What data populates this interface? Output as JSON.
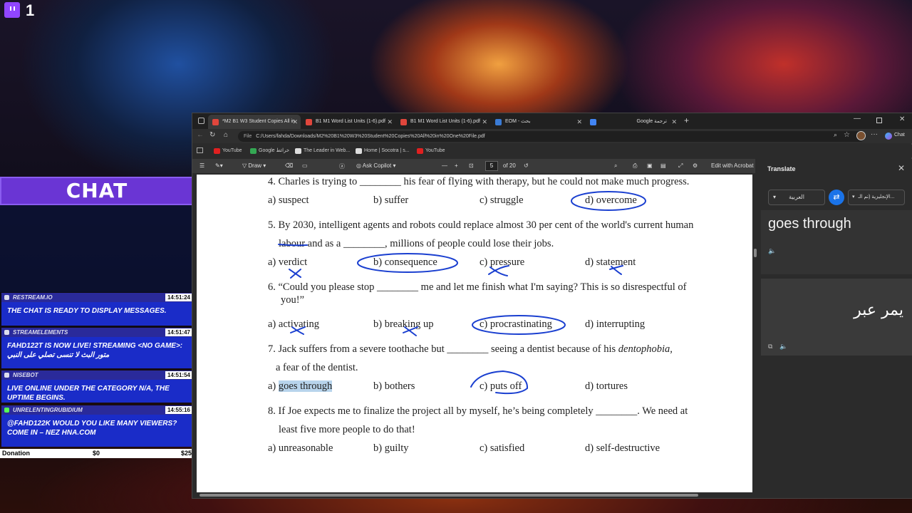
{
  "twitch": {
    "viewer_count": "1"
  },
  "chat": {
    "header": "CHAT",
    "messages": [
      {
        "user": "RESTREAM.IO",
        "time": "14:51:24",
        "text": "THE CHAT IS READY TO DISPLAY MESSAGES."
      },
      {
        "user": "STREAMELEMENTS",
        "time": "14:51:47",
        "text": "FAHD122T IS NOW LIVE! STREAMING <NO GAME>: متور البث لا تنسى تصلي على النبي"
      },
      {
        "user": "NISEBOT",
        "time": "14:51:54",
        "text": "LIVE ONLINE UNDER THE CATEGORY N/A, THE UPTIME BEGINS."
      },
      {
        "user": "UNRELENTINGRUBIDIUM",
        "time": "14:55:16",
        "text": "@FAHD122K WOULD YOU LIKE MANY VIEWERS? COME IN – NEZ HNA.COM"
      }
    ],
    "donation": {
      "label": "Donation",
      "current": "$0",
      "goal": "$25"
    }
  },
  "browser": {
    "tabs": [
      {
        "label": "*M2 B1 W3 Student Copies All in",
        "active": true
      },
      {
        "label": "B1 M1 Word List Units (1-6).pdf",
        "active": false
      },
      {
        "label": "B1 M1 Word List Units (1-6).pdf",
        "active": false
      },
      {
        "label": "EOM - بحث",
        "active": false
      },
      {
        "label": "Google ترجمة",
        "active": false
      }
    ],
    "address": "C:/Users/fahda/Downloads/M2%20B1%20W3%20Student%20Copies%20All%20in%20One%20File.pdf",
    "address_prefix": "File",
    "chat_label": "Chat",
    "bookmarks": [
      "YouTube",
      "Google خرائط",
      "The Leader in Web...",
      "Home | Socotra | s...",
      "YouTube"
    ]
  },
  "pdf_toolbar": {
    "draw": "Draw",
    "ask_copilot": "Ask Copilot",
    "page": "5",
    "page_total": "of 20",
    "edit_acrobat": "Edit with Acrobat"
  },
  "questions": [
    {
      "num": "4.",
      "text": "Charles is trying to  ________  his fear of flying with therapy, but he could not make much progress.",
      "options": [
        "a) suspect",
        "b) suffer",
        "c) struggle",
        "d) overcome"
      ]
    },
    {
      "num": "5.",
      "text": "By 2030, intelligent agents and robots could replace almost 30 per cent of the world's current human",
      "text2": "labour and as a ________, millions of people could lose their jobs.",
      "options": [
        "a) verdict",
        "b) consequence",
        "c) pressure",
        "d) statement"
      ]
    },
    {
      "num": "6.",
      "text": "“Could you please stop ________ me and let me finish what I'm saying? This is so disrespectful of",
      "text2": "you!”",
      "options": [
        "a) activating",
        "b) breaking up",
        "c) procrastinating",
        "d) interrupting"
      ]
    },
    {
      "num": "7.",
      "text": "Jack suffers from a severe toothache but ________ seeing a dentist because of his",
      "text_italic": "dentophobia,",
      "text2": "a fear of the dentist.",
      "options": [
        "a) goes through",
        "b) bothers",
        "c) puts off",
        "d) tortures"
      ]
    },
    {
      "num": "8.",
      "text": "If Joe expects me to finalize the project all by myself, he’s being completely ________. We need at",
      "text2": "least five more people to do that!",
      "options": [
        "a) unreasonable",
        "b) guilty",
        "c) satisfied",
        "d) self-destructive"
      ]
    }
  ],
  "translate": {
    "title": "Translate",
    "source_lang": "العربية",
    "target_lang": "الإنجليزية (تم الـ...",
    "source_text": "goes through",
    "translated_text": "يمر عبر"
  }
}
